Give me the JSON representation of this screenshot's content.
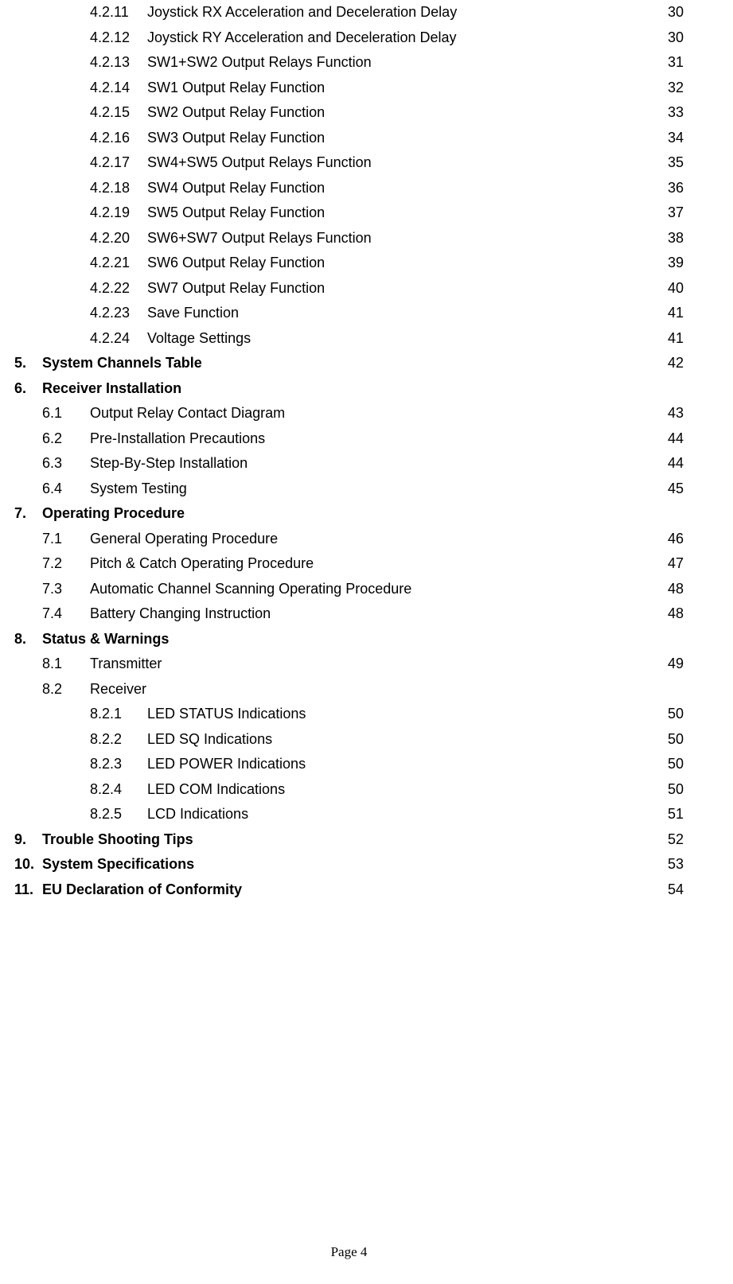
{
  "toc": [
    {
      "level": 2,
      "num": "4.2.11",
      "title": "Joystick RX Acceleration and Deceleration Delay",
      "page": "30",
      "bold": false
    },
    {
      "level": 2,
      "num": "4.2.12",
      "title": "Joystick RY Acceleration and Deceleration Delay",
      "page": "30",
      "bold": false
    },
    {
      "level": 2,
      "num": "4.2.13",
      "title": "SW1+SW2 Output Relays Function",
      "page": "31",
      "bold": false
    },
    {
      "level": 2,
      "num": "4.2.14",
      "title": "SW1 Output Relay Function",
      "page": "32",
      "bold": false
    },
    {
      "level": 2,
      "num": "4.2.15",
      "title": "SW2 Output Relay Function",
      "page": "33",
      "bold": false
    },
    {
      "level": 2,
      "num": "4.2.16",
      "title": "SW3 Output Relay Function",
      "page": "34",
      "bold": false
    },
    {
      "level": 2,
      "num": "4.2.17",
      "title": "SW4+SW5 Output Relays Function",
      "page": "35",
      "bold": false
    },
    {
      "level": 2,
      "num": "4.2.18",
      "title": "SW4 Output Relay Function",
      "page": "36",
      "bold": false
    },
    {
      "level": 2,
      "num": "4.2.19",
      "title": "SW5 Output Relay Function",
      "page": "37",
      "bold": false
    },
    {
      "level": 2,
      "num": "4.2.20",
      "title": "SW6+SW7 Output Relays Function",
      "page": "38",
      "bold": false
    },
    {
      "level": 2,
      "num": "4.2.21",
      "title": "SW6 Output Relay Function",
      "page": "39",
      "bold": false
    },
    {
      "level": 2,
      "num": "4.2.22",
      "title": "SW7 Output Relay Function",
      "page": "40",
      "bold": false
    },
    {
      "level": 2,
      "num": "4.2.23",
      "title": "Save Function",
      "page": "41",
      "bold": false
    },
    {
      "level": 2,
      "num": "4.2.24",
      "title": "Voltage Settings",
      "page": "41",
      "bold": false
    },
    {
      "level": 0,
      "num": "5.",
      "title": "System Channels Table",
      "page": "42",
      "bold": true
    },
    {
      "level": 0,
      "num": "6.",
      "title": "Receiver Installation",
      "page": "",
      "bold": true
    },
    {
      "level": 1,
      "num": "6.1",
      "title": "Output Relay Contact Diagram",
      "page": "43",
      "bold": false
    },
    {
      "level": 1,
      "num": "6.2",
      "title": "Pre-Installation Precautions",
      "page": "44",
      "bold": false
    },
    {
      "level": 1,
      "num": "6.3",
      "title": "Step-By-Step Installation",
      "page": "44",
      "bold": false
    },
    {
      "level": 1,
      "num": "6.4",
      "title": "System Testing",
      "page": "45",
      "bold": false
    },
    {
      "level": 0,
      "num": "7.",
      "title": "Operating Procedure",
      "page": "",
      "bold": true
    },
    {
      "level": 1,
      "num": "7.1",
      "title": "General Operating Procedure",
      "page": "46",
      "bold": false
    },
    {
      "level": 1,
      "num": "7.2",
      "title": "Pitch & Catch Operating Procedure",
      "page": "47",
      "bold": false
    },
    {
      "level": 1,
      "num": "7.3",
      "title": "Automatic Channel Scanning Operating Procedure",
      "page": "48",
      "bold": false
    },
    {
      "level": 1,
      "num": "7.4",
      "title": "Battery Changing Instruction",
      "page": "48",
      "bold": false
    },
    {
      "level": 0,
      "num": "8.",
      "title": "Status & Warnings",
      "page": "",
      "bold": true
    },
    {
      "level": 1,
      "num": "8.1",
      "title": "Transmitter",
      "page": "49",
      "bold": false
    },
    {
      "level": 1,
      "num": "8.2",
      "title": "Receiver",
      "page": "",
      "bold": false
    },
    {
      "level": 2,
      "num": "8.2.1",
      "title": "LED STATUS Indications",
      "page": "50",
      "bold": false
    },
    {
      "level": 2,
      "num": "8.2.2",
      "title": "LED SQ Indications",
      "page": "50",
      "bold": false
    },
    {
      "level": 2,
      "num": "8.2.3",
      "title": "LED POWER Indications",
      "page": "50",
      "bold": false
    },
    {
      "level": 2,
      "num": "8.2.4",
      "title": "LED COM Indications",
      "page": "50",
      "bold": false
    },
    {
      "level": 2,
      "num": "8.2.5",
      "title": "LCD Indications",
      "page": "51",
      "bold": false
    },
    {
      "level": 0,
      "num": "9.",
      "title": "Trouble Shooting Tips",
      "page": "52",
      "bold": true
    },
    {
      "level": 0,
      "num": "10.",
      "title": "System Specifications",
      "page": "53",
      "bold": true
    },
    {
      "level": 0,
      "num": "11.",
      "title": "EU Declaration of Conformity",
      "page": "54",
      "bold": true
    }
  ],
  "footer": "Page 4"
}
